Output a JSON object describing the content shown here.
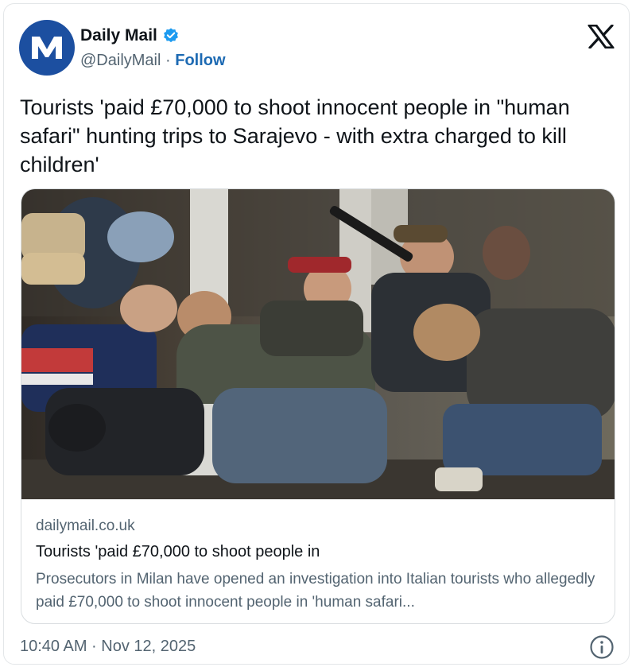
{
  "account": {
    "name": "Daily Mail",
    "handle": "@DailyMail",
    "separator": "·",
    "follow_label": "Follow",
    "verified_color": "#1d9bf0",
    "avatar_color": "#1c4fa0"
  },
  "icons": {
    "avatar_logo": "daily-mail-logo",
    "verified": "verified-badge-icon",
    "platform": "x-logo-icon",
    "info": "info-icon"
  },
  "tweet": {
    "text": "Tourists 'paid £70,000 to shoot innocent people in \"human safari\" hunting trips to Sarajevo - with extra charged to kill children'",
    "timestamp": "10:40 AM · Nov 12, 2025"
  },
  "link_card": {
    "domain": "dailymail.co.uk",
    "title": "Tourists 'paid £70,000 to shoot people in",
    "description": "Prosecutors in Milan have opened an investigation into Italian tourists who allegedly paid £70,000 to shoot innocent people in 'human safari..."
  }
}
